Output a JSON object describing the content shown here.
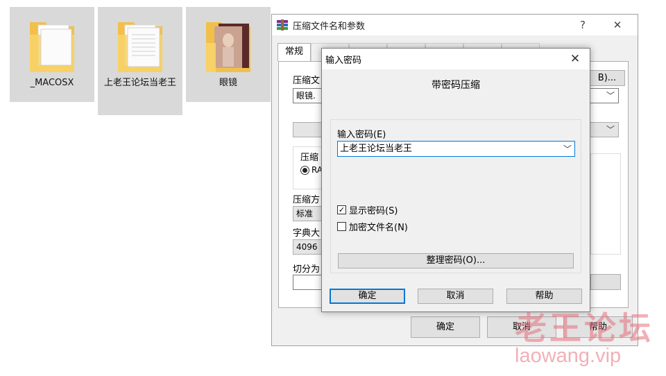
{
  "desktop": {
    "files": [
      {
        "name": "_MACOSX",
        "icon": "folder-icon"
      },
      {
        "name": "上老王论坛当老王",
        "icon": "folder-icon"
      },
      {
        "name": "眼镜",
        "icon": "folder-icon"
      }
    ]
  },
  "archive_dialog": {
    "title": "压缩文件名和参数",
    "help_glyph": "?",
    "close_glyph": "✕",
    "tab_general": "常规",
    "label_archive_name": "压缩文",
    "archive_name_value": "眼镜.",
    "browse_button": "B)...",
    "label_format": "压缩",
    "format_option": "RA",
    "label_method": "压缩方",
    "method_value": "标准",
    "label_dict": "字典大",
    "dict_value": "4096",
    "label_split": "切分为",
    "ok_button": "确定",
    "cancel_button": "取消",
    "help_button": "帮助"
  },
  "password_dialog": {
    "title": "输入密码",
    "close_glyph": "✕",
    "heading": "带密码压缩",
    "label_password": "输入密码(E)",
    "password_value": "上老王论坛当老王",
    "show_password_label": "显示密码(S)",
    "show_password_checked": true,
    "encrypt_names_label": "加密文件名(N)",
    "encrypt_names_checked": false,
    "organize_button": "整理密码(O)...",
    "ok_button": "确定",
    "cancel_button": "取消",
    "help_button": "帮助"
  },
  "watermark": {
    "cn": "老王论坛",
    "en": "laowang.vip"
  },
  "colors": {
    "folder": "#f5c84c",
    "focus_border": "#0078d7",
    "watermark": "#e56f7b"
  }
}
